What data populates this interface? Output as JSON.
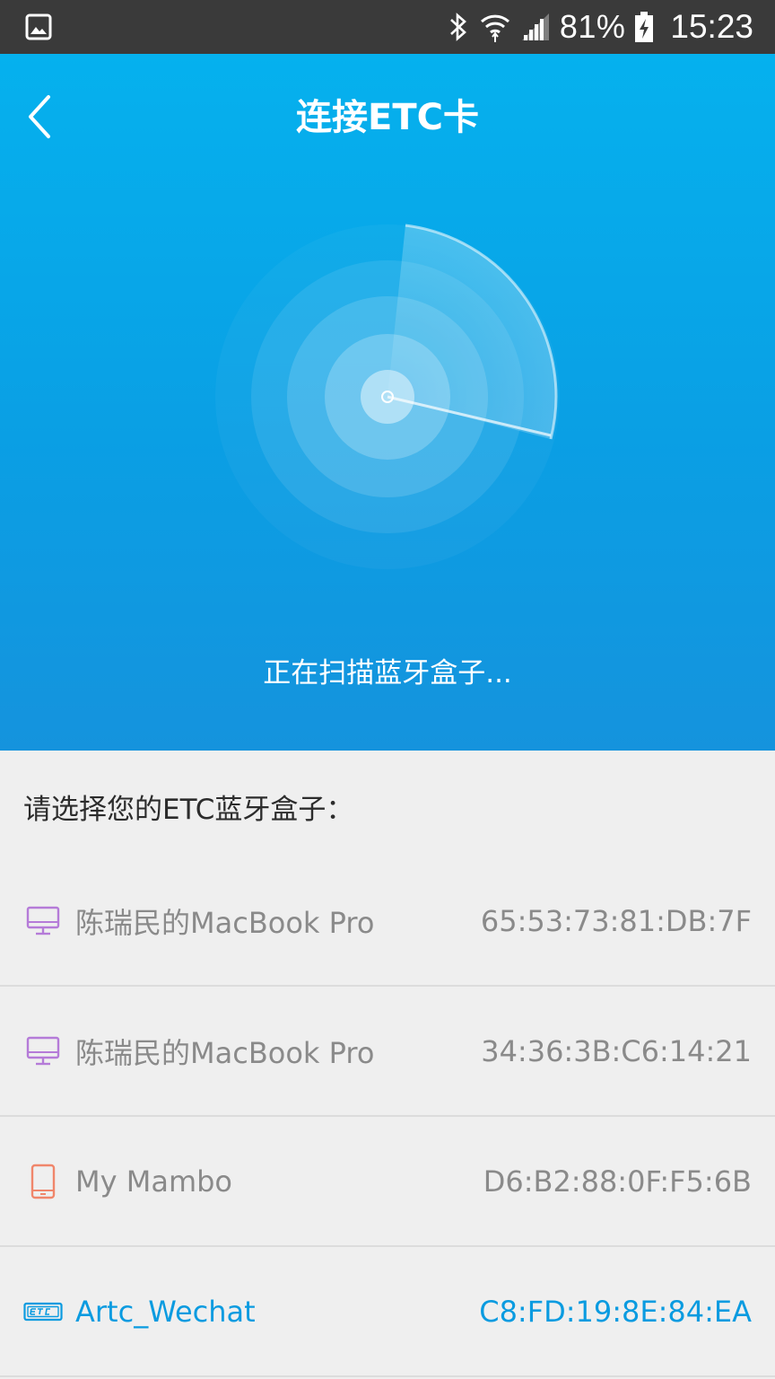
{
  "status_bar": {
    "battery": "81%",
    "time": "15:23",
    "icons": [
      "gallery-icon",
      "bluetooth-icon",
      "wifi-icon",
      "signal-icon",
      "battery-charging-icon"
    ]
  },
  "header": {
    "title": "连接ETC卡",
    "back_icon": "chevron-left-icon",
    "scan_status": "正在扫描蓝牙盒子..."
  },
  "prompt": "请选择您的ETC蓝牙盒子：",
  "devices": [
    {
      "name": "陈瑞民的MacBook Pro",
      "mac": "65:53:73:81:DB:7F",
      "icon": "computer-icon",
      "icon_color": "#b57bd8",
      "active": false
    },
    {
      "name": "陈瑞民的MacBook Pro",
      "mac": "34:36:3B:C6:14:21",
      "icon": "computer-icon",
      "icon_color": "#b57bd8",
      "active": false
    },
    {
      "name": "My Mambo",
      "mac": "D6:B2:88:0F:F5:6B",
      "icon": "phone-icon",
      "icon_color": "#f0866b",
      "active": false
    },
    {
      "name": "Artc_Wechat",
      "mac": "C8:FD:19:8E:84:EA",
      "icon": "etc-icon",
      "icon_color": "#0a9be0",
      "active": true
    }
  ],
  "colors": {
    "header_top": "#05b1ee",
    "header_bottom": "#1593dd",
    "accent": "#0a9be0",
    "list_background": "#efefef"
  }
}
